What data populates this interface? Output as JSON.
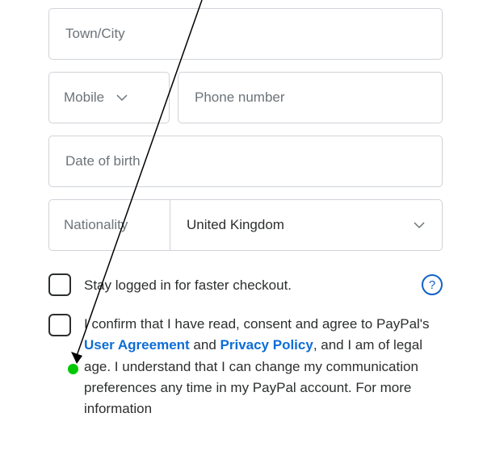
{
  "fields": {
    "town": {
      "placeholder": "Town/City"
    },
    "phone_type": {
      "label": "Mobile"
    },
    "phone_number": {
      "placeholder": "Phone number"
    },
    "dob": {
      "placeholder": "Date of birth"
    },
    "nationality": {
      "label": "Nationality",
      "value": "United Kingdom"
    }
  },
  "stay_logged": {
    "label": "Stay logged in for faster checkout.",
    "help": "?"
  },
  "consent": {
    "part1": "I confirm that I have read, consent and agree to PayPal's ",
    "link1": "User Agreement",
    "mid": " and ",
    "link2": "Privacy Policy",
    "part2": ", and I am of legal age. I understand that I can change my communication preferences any time in my PayPal account. For more information"
  },
  "colors": {
    "link": "#0d6dd6",
    "border": "#cfd3d8",
    "placeholder": "#6c7378",
    "annotation_dot": "#00c800"
  }
}
